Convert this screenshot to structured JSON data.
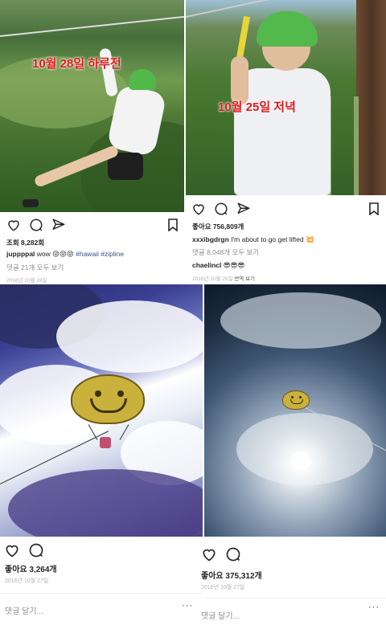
{
  "post1": {
    "overlay": "10월 28일 하루전",
    "views": "조회 8,282회",
    "username": "juppppal",
    "caption": "wow 😝😝😝",
    "hashtags": "#hawaii #zipline",
    "comments_link": "댓글 21개 모두 보기",
    "date": "2016년 10월 28일"
  },
  "post2": {
    "overlay": "10월 25일 저녁",
    "likes": "좋아요 756,809개",
    "username": "xxxibgdrgn",
    "caption": "I'm about to go get lifted 💥",
    "comments_link": "댓글 8,048개 모두 보기",
    "commenter": "chaelincl",
    "comment": "😎😎😎",
    "date": "2016년 10월 25일",
    "translate": "번역 보기"
  },
  "post3": {
    "likes": "좋아요 3,264개",
    "date": "2016년 10월 27일",
    "add_comment": "댓글 달기...",
    "more": "···"
  },
  "post4": {
    "likes": "좋아요 375,312개",
    "date": "2016년 10월 27일",
    "add_comment": "댓글 달기...",
    "more": "···"
  },
  "icons": {
    "like": "heart-icon",
    "comment": "comment-icon",
    "share": "send-icon",
    "save": "bookmark-icon"
  }
}
